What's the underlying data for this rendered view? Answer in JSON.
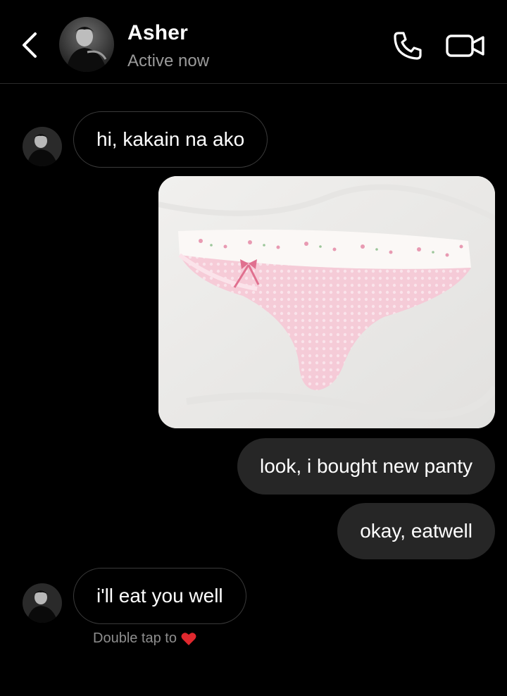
{
  "header": {
    "contact_name": "Asher",
    "status": "Active now",
    "back_icon": "chevron-left-icon",
    "call_icon": "phone-icon",
    "video_icon": "video-camera-icon"
  },
  "messages": [
    {
      "direction": "incoming",
      "type": "text",
      "text": "hi, kakain na ako"
    },
    {
      "direction": "outgoing",
      "type": "image",
      "description_icon": "photo-attachment"
    },
    {
      "direction": "outgoing",
      "type": "text",
      "text": "look, i bought new panty"
    },
    {
      "direction": "outgoing",
      "type": "text",
      "text": "okay, eatwell"
    },
    {
      "direction": "incoming",
      "type": "text",
      "text": "i'll eat you well"
    }
  ],
  "footer_hint": {
    "text": "Double tap to",
    "icon": "heart-icon",
    "icon_color": "#e0282e"
  },
  "colors": {
    "background": "#000000",
    "outgoing_bubble": "#262626",
    "incoming_border": "#3a3a3a",
    "status_text": "#9a9a9a"
  }
}
